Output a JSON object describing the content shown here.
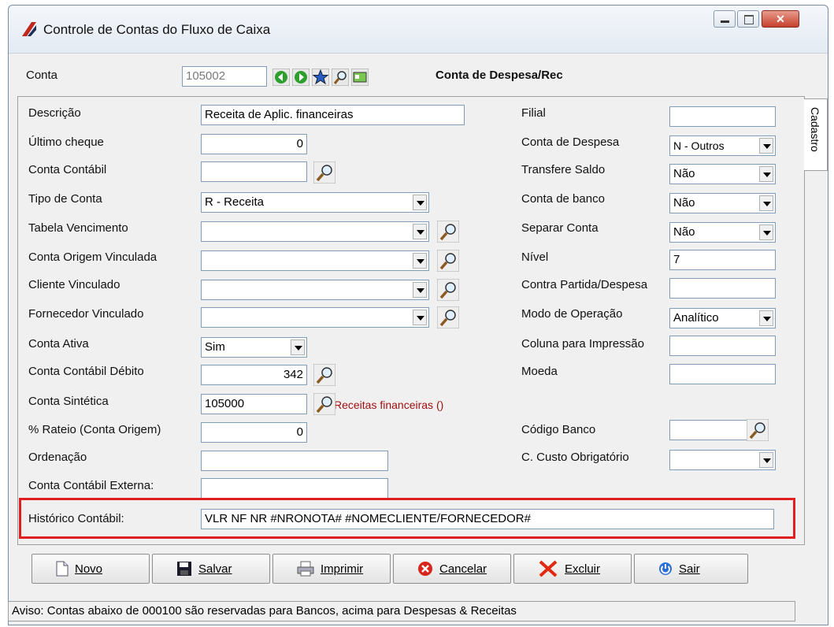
{
  "window": {
    "title": "Controle de Contas do Fluxo de Caixa"
  },
  "header": {
    "conta_label": "Conta",
    "conta_value": "105002",
    "conta_type_label": "Conta de Despesa/Rec"
  },
  "tab": {
    "label": "Cadastro"
  },
  "left_fields": {
    "descricao": {
      "label": "Descrição",
      "value": "Receita de Aplic. financeiras"
    },
    "ultimo_cheque": {
      "label": "Último cheque",
      "value": "0"
    },
    "conta_contabil": {
      "label": "Conta Contábil",
      "value": ""
    },
    "tipo_conta": {
      "label": "Tipo de Conta",
      "value": "R - Receita"
    },
    "tabela_vencimento": {
      "label": "Tabela Vencimento",
      "value": ""
    },
    "conta_origem_vinculada": {
      "label": "Conta Origem Vinculada",
      "value": ""
    },
    "cliente_vinculado": {
      "label": "Cliente Vinculado",
      "value": ""
    },
    "fornecedor_vinculado": {
      "label": "Fornecedor Vinculado",
      "value": ""
    },
    "conta_ativa": {
      "label": "Conta Ativa",
      "value": "Sim"
    },
    "conta_contabil_debito": {
      "label": "Conta Contábil Débito",
      "value": "342"
    },
    "conta_sintetica": {
      "label": "Conta Sintética",
      "value": "105000",
      "desc": "Receitas financeiras ()"
    },
    "rateio": {
      "label": "% Rateio (Conta Origem)",
      "value": "0"
    },
    "ordenacao": {
      "label": "Ordenação",
      "value": ""
    },
    "conta_contabil_externa": {
      "label": "Conta Contábil Externa:",
      "value": ""
    },
    "historico_contabil": {
      "label": "Histórico Contábil:",
      "value": "VLR NF NR #NRONOTA# #NOMECLIENTE/FORNECEDOR#"
    }
  },
  "right_fields": {
    "filial": {
      "label": "Filial",
      "value": ""
    },
    "conta_despesa": {
      "label": "Conta de Despesa",
      "value": "N - Outros"
    },
    "transfere_saldo": {
      "label": "Transfere Saldo",
      "value": "Não"
    },
    "conta_banco": {
      "label": "Conta de banco",
      "value": "Não"
    },
    "separar_conta": {
      "label": "Separar Conta",
      "value": "Não"
    },
    "nivel": {
      "label": "Nível",
      "value": "7"
    },
    "contra_partida": {
      "label": "Contra Partida/Despesa",
      "value": ""
    },
    "modo_operacao": {
      "label": "Modo de Operação",
      "value": "Analítico"
    },
    "coluna_impressao": {
      "label": "Coluna para Impressão",
      "value": ""
    },
    "moeda": {
      "label": "Moeda",
      "value": ""
    },
    "codigo_banco": {
      "label": "Código Banco",
      "value": ""
    },
    "custo_obrigatorio": {
      "label": "C. Custo Obrigatório",
      "value": ""
    }
  },
  "buttons": {
    "novo": "Novo",
    "salvar": "Salvar",
    "imprimir": "Imprimir",
    "cancelar": "Cancelar",
    "excluir": "Excluir",
    "sair": "Sair"
  },
  "status": {
    "text": "Aviso: Contas abaixo de 000100 são reservadas para Bancos, acima para Despesas & Receitas"
  },
  "colors": {
    "highlight_border": "#e02020",
    "desc_text": "#a01010"
  }
}
